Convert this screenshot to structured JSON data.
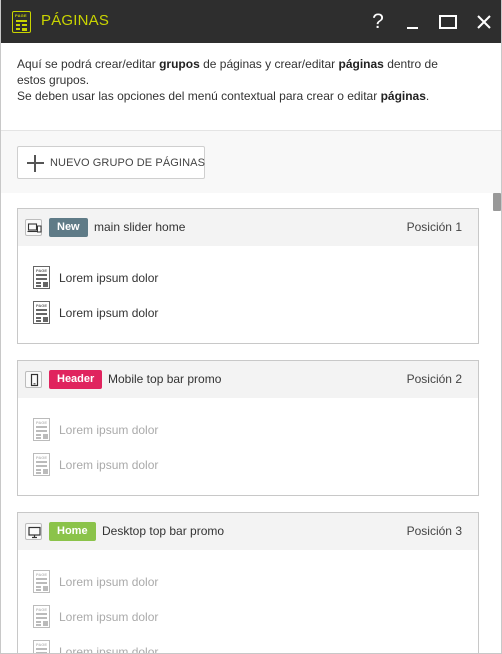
{
  "window": {
    "title": "PÁGINAS",
    "help_label": "?",
    "accent_color": "#c9d400",
    "app_icon_text": "PAGE"
  },
  "description": {
    "line1": [
      {
        "text": "Aquí se podrá crear/editar ",
        "bold": false
      },
      {
        "text": "grupos",
        "bold": true
      },
      {
        "text": " de páginas y crear/editar ",
        "bold": false
      },
      {
        "text": "páginas",
        "bold": true
      },
      {
        "text": " dentro de estos grupos.",
        "bold": false
      }
    ],
    "line2": [
      {
        "text": "Se deben usar las opciones del menú contextual para crear o editar ",
        "bold": false
      },
      {
        "text": "páginas",
        "bold": true
      },
      {
        "text": ".",
        "bold": false
      }
    ]
  },
  "toolbar": {
    "new_group_label": "NUEVO GRUPO DE PÁGINAS"
  },
  "groups": [
    {
      "device_icon": "devices-icon",
      "badge": "New",
      "badge_color": "#5f7b87",
      "name": "main slider home",
      "position": "Posición 1",
      "active": true,
      "pages": [
        "Lorem ipsum dolor",
        "Lorem ipsum dolor"
      ]
    },
    {
      "device_icon": "mobile-icon",
      "badge": "Header",
      "badge_color": "#e0245e",
      "name": "Mobile top bar promo",
      "position": "Posición 2",
      "active": false,
      "pages": [
        "Lorem ipsum dolor",
        "Lorem ipsum dolor"
      ]
    },
    {
      "device_icon": "desktop-icon",
      "badge": "Home",
      "badge_color": "#8bc34a",
      "name": "Desktop top bar promo",
      "position": "Posición 3",
      "active": false,
      "pages": [
        "Lorem ipsum dolor",
        "Lorem ipsum dolor",
        "Lorem ipsum dolor"
      ]
    }
  ]
}
